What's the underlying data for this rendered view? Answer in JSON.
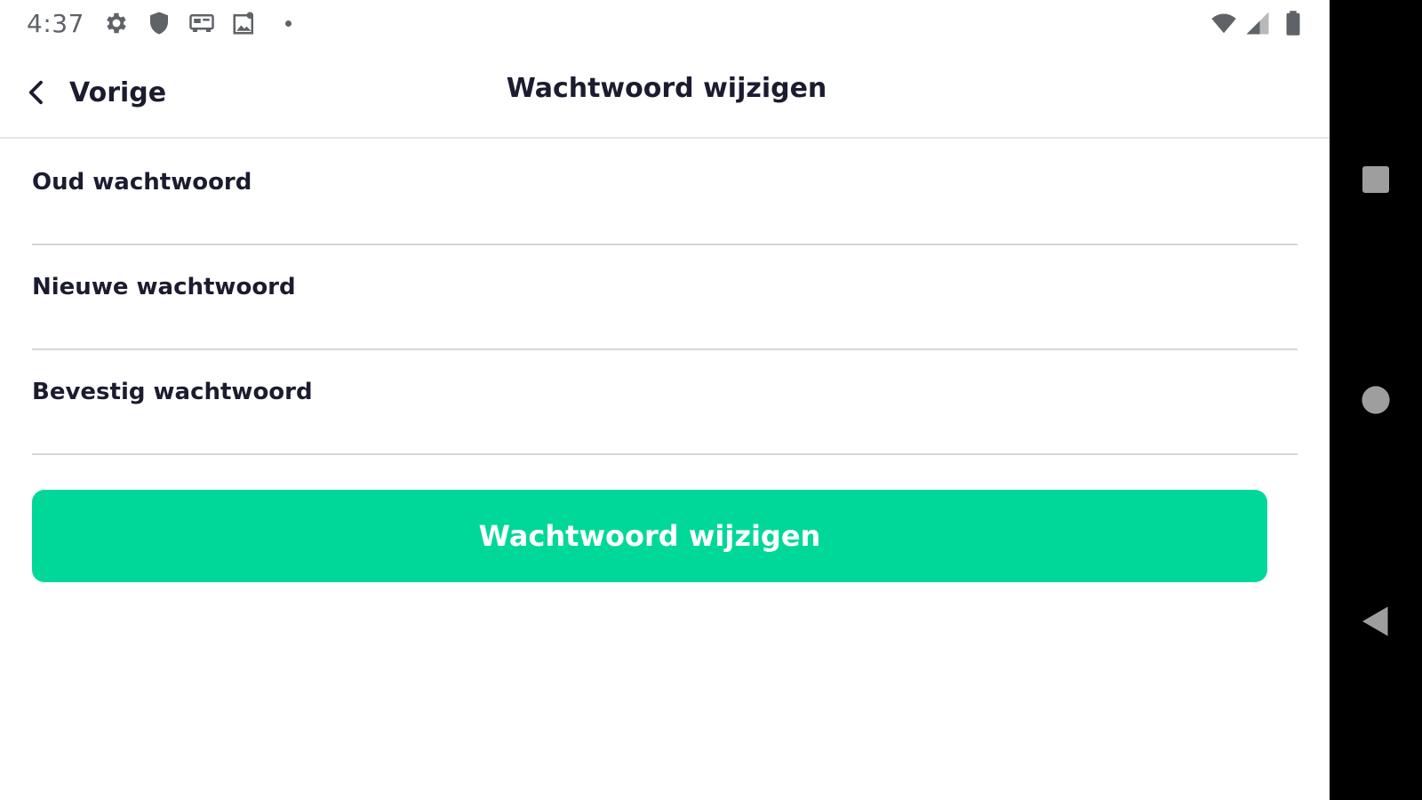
{
  "status_bar": {
    "time": "4:37",
    "icons": [
      "gear-icon",
      "shield-icon",
      "cast-icon",
      "photo-icon",
      "wifi-icon",
      "signal-icon",
      "battery-icon"
    ]
  },
  "app_bar": {
    "back_label": "Vorige",
    "title": "Wachtwoord wijzigen"
  },
  "form": {
    "fields": [
      {
        "label": "Oud wachtwoord",
        "value": ""
      },
      {
        "label": "Nieuwe wachtwoord",
        "value": ""
      },
      {
        "label": "Bevestig wachtwoord",
        "value": ""
      }
    ],
    "submit_label": "Wachtwoord wijzigen"
  },
  "nav_bar": {
    "buttons": [
      "recents-icon",
      "home-icon",
      "back-icon"
    ]
  },
  "colors": {
    "accent": "#00d899",
    "text": "#1c1c30",
    "status": "#5f6368",
    "divider": "#d6d6d6",
    "nav_background": "#000000"
  }
}
